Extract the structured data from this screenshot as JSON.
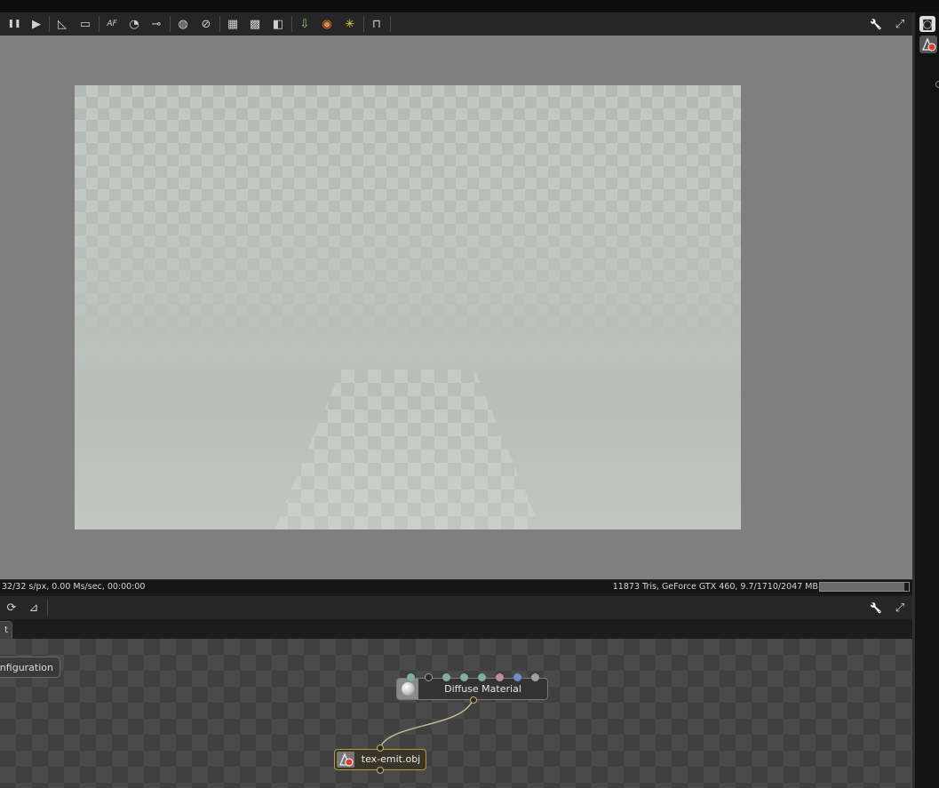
{
  "viewer": {
    "toolbar_buttons": [
      {
        "name": "pause-icon",
        "glyph": "❚❚"
      },
      {
        "name": "play-icon",
        "glyph": "▶"
      },
      {
        "name": "ruler-icon",
        "glyph": "◺"
      },
      {
        "name": "monitor-icon",
        "glyph": "▭"
      },
      {
        "name": "autofocus-icon",
        "glyph": "AF"
      },
      {
        "name": "rotate-icon",
        "glyph": "◔"
      },
      {
        "name": "focus-picker-icon",
        "glyph": "⊸"
      },
      {
        "name": "region-render-icon",
        "glyph": "◍"
      },
      {
        "name": "clear-region-icon",
        "glyph": "⊘"
      },
      {
        "name": "alpha-channel-icon",
        "glyph": "▦"
      },
      {
        "name": "checker-icon",
        "glyph": "▩"
      },
      {
        "name": "split-view-icon",
        "glyph": "◧"
      },
      {
        "name": "export-icon",
        "glyph": "⇩"
      },
      {
        "name": "material-picker-icon",
        "glyph": "◉"
      },
      {
        "name": "light-picker-icon",
        "glyph": "✳"
      },
      {
        "name": "lock-icon",
        "glyph": "⊓"
      }
    ],
    "wrench_icon": "🔧",
    "maximize_icon": "⤢",
    "status_left": "32/32 s/px, 0.00 Ms/sec, 00:00:00",
    "status_right": "11873 Tris, GeForce GTX 460, 9.7/1710/2047 MB",
    "memory_used_fraction": 0.95
  },
  "graph_editor": {
    "toolbar_buttons": [
      {
        "name": "rotate-view-icon",
        "glyph": "⟳"
      },
      {
        "name": "layout-icon",
        "glyph": "⊿"
      }
    ],
    "tab_label": "t",
    "nodes": {
      "config": {
        "label": "onfiguration"
      },
      "material": {
        "label": "Diffuse Material"
      },
      "mesh": {
        "label": "tex-emit.obj"
      }
    },
    "material_pin_colors": [
      "#7fb0a0",
      "#2a2a2a",
      "#7fb0a0",
      "#7fb0a0",
      "#7fb0a0",
      "#c08aa8",
      "#6f8fc8",
      "#9aa0a6"
    ]
  },
  "colors": {
    "viewport_bg": "#7f7f7f",
    "toolbar_bg": "#262626",
    "mesh_node_border": "#b09a3a",
    "link": "#c9b88a"
  }
}
